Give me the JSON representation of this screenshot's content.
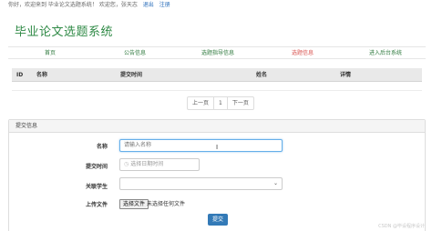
{
  "topbar": {
    "welcome": "你好，欢迎来到 毕业论文选题系统！ 欢迎您，张天志",
    "logout": "退出",
    "register": "注册"
  },
  "site": {
    "title": "毕业论文选题系统"
  },
  "nav": {
    "items": [
      {
        "label": "首页"
      },
      {
        "label": "公告信息"
      },
      {
        "label": "选题指导信息"
      },
      {
        "label": "选题信息"
      },
      {
        "label": "进入后台系统"
      }
    ],
    "active_color": "#d9534f"
  },
  "table": {
    "columns": [
      "ID",
      "名称",
      "提交时间",
      "姓名",
      "详情"
    ]
  },
  "pager": {
    "prev": "上一页",
    "page": "1",
    "next": "下一页"
  },
  "form": {
    "panel_title": "提交信息",
    "name_label": "名称",
    "name_placeholder": "请输入名称",
    "time_label": "提交时间",
    "time_placeholder": "选择日期时间",
    "student_label": "关联学生",
    "student_value": "",
    "file_label": "上传文件",
    "file_button": "选择文件",
    "file_status": "未选择任何文件",
    "submit": "提交"
  },
  "watermark": "CSDN @毕设程序设计"
}
